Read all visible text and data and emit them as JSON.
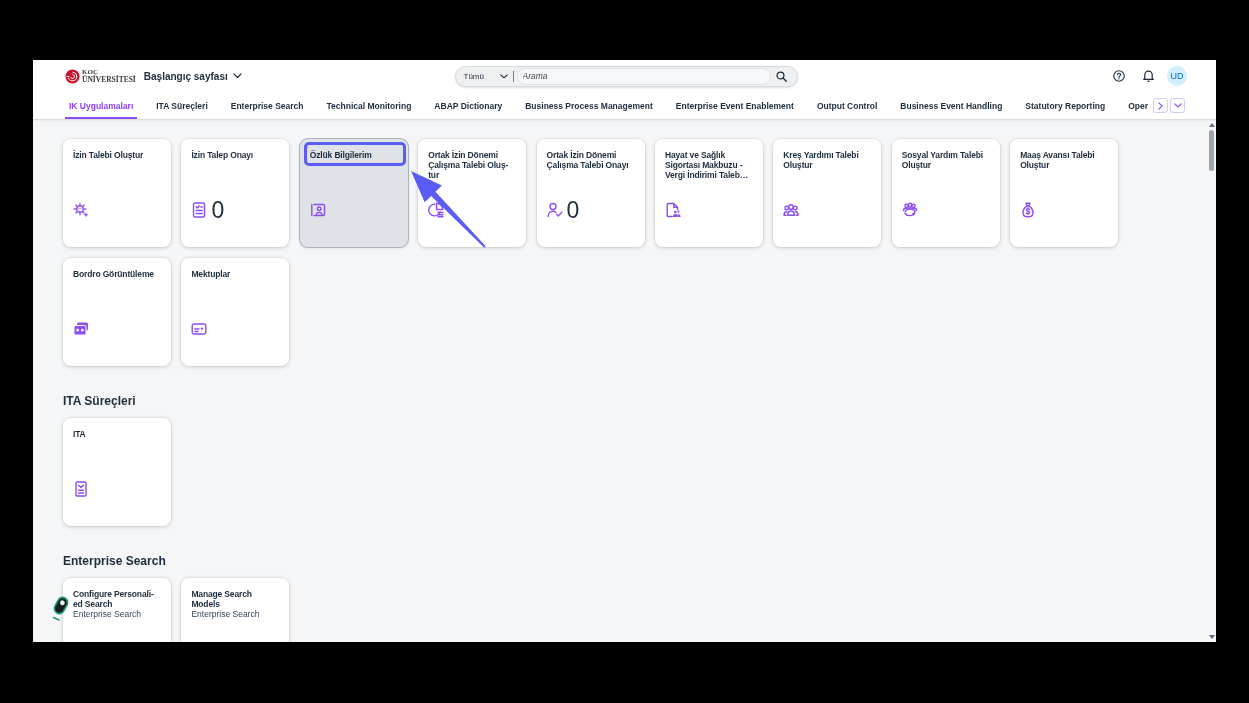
{
  "header": {
    "logo": {
      "line_1": "KOÇ",
      "line_2": "ÜNİVERSİTESİ"
    },
    "title": "Başlangıç sayfası",
    "search": {
      "scope": "Tümü",
      "placeholder": "Arama"
    },
    "avatar": "UD"
  },
  "tabs": [
    {
      "label": "IK Uygulamaları",
      "selected": true
    },
    {
      "label": "ITA Süreçleri",
      "selected": false
    },
    {
      "label": "Enterprise Search",
      "selected": false
    },
    {
      "label": "Technical Monitoring",
      "selected": false
    },
    {
      "label": "ABAP Dictionary",
      "selected": false
    },
    {
      "label": "Business Process Management",
      "selected": false
    },
    {
      "label": "Enterprise Event Enablement",
      "selected": false
    },
    {
      "label": "Output Control",
      "selected": false
    },
    {
      "label": "Business Event Handling",
      "selected": false
    },
    {
      "label": "Statutory Reporting",
      "selected": false
    },
    {
      "label": "Oper",
      "selected": false
    }
  ],
  "sections": [
    {
      "tiles": [
        {
          "title": "İzin Talebi Oluştur",
          "highlighted": false
        },
        {
          "title": "İzin Talep Onayı",
          "count": "0",
          "highlighted": false
        },
        {
          "title": "Özlük Bilgilerim",
          "highlighted": true
        },
        {
          "title": "Ortak İzin Dönemi Çalışma Talebi Oluş-tur",
          "highlighted": false
        },
        {
          "title": "Ortak İzin Dönemi Çalışma Talebi Onayı",
          "count": "0",
          "highlighted": false
        },
        {
          "title": "Hayat ve Sağlık Sigortası Makbuzu - Vergi İndirimi Taleb…",
          "highlighted": false
        },
        {
          "title": "Kreş Yardımı Talebi Oluştur",
          "highlighted": false
        },
        {
          "title": "Sosyal Yardım Talebi Oluştur",
          "highlighted": false
        },
        {
          "title": "Maaş Avansı Talebi Oluştur",
          "highlighted": false
        },
        {
          "title": "Bordro Görüntüleme",
          "highlighted": false
        },
        {
          "title": "Mektuplar",
          "highlighted": false
        }
      ]
    },
    {
      "title": "ITA Süreçleri",
      "tiles": [
        {
          "title": "ITA",
          "highlighted": false
        }
      ]
    },
    {
      "title": "Enterprise Search",
      "tiles": [
        {
          "title": "Configure Personali-ed Search",
          "subtitle": "Enterprise Search",
          "highlighted": false
        },
        {
          "title": "Manage Search Models",
          "subtitle": "Enterprise Search",
          "highlighted": false
        }
      ]
    }
  ]
}
